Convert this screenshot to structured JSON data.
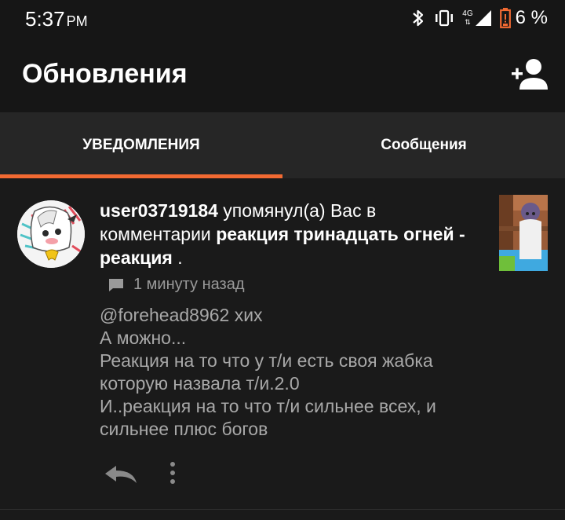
{
  "status_bar": {
    "time": "5:37",
    "ampm": "PM",
    "network": "4G",
    "battery": "6 %",
    "icons": [
      "bluetooth-icon",
      "vibrate-icon",
      "signal-icon",
      "battery-icon"
    ],
    "battery_color": "#f26a32"
  },
  "app_bar": {
    "title": "Обновления",
    "action_icon": "add-user-icon"
  },
  "tabs": [
    {
      "label": "УВЕДОМЛЕНИЯ",
      "active": true
    },
    {
      "label": "Сообщения",
      "active": false
    }
  ],
  "notification": {
    "username": "user03719184",
    "action": " упомянул(а) Вас в комментарии ",
    "post_title": "реакция тринадцать огней - реакция",
    "suffix": " .",
    "time": "1 минуту назад",
    "comment_lines": [
      "@forehead8962 хих",
      "А можно...",
      "Реакция на то что у т/и есть своя жабка",
      "которую назвала т/и.2.0",
      "И..реакция на то что т/и сильнее всех, и",
      "сильнее плюс богов"
    ]
  },
  "colors": {
    "accent": "#f26a32",
    "background": "#1a1a1a",
    "tab_bar": "#262626",
    "secondary_text": "#a8a8a8"
  }
}
